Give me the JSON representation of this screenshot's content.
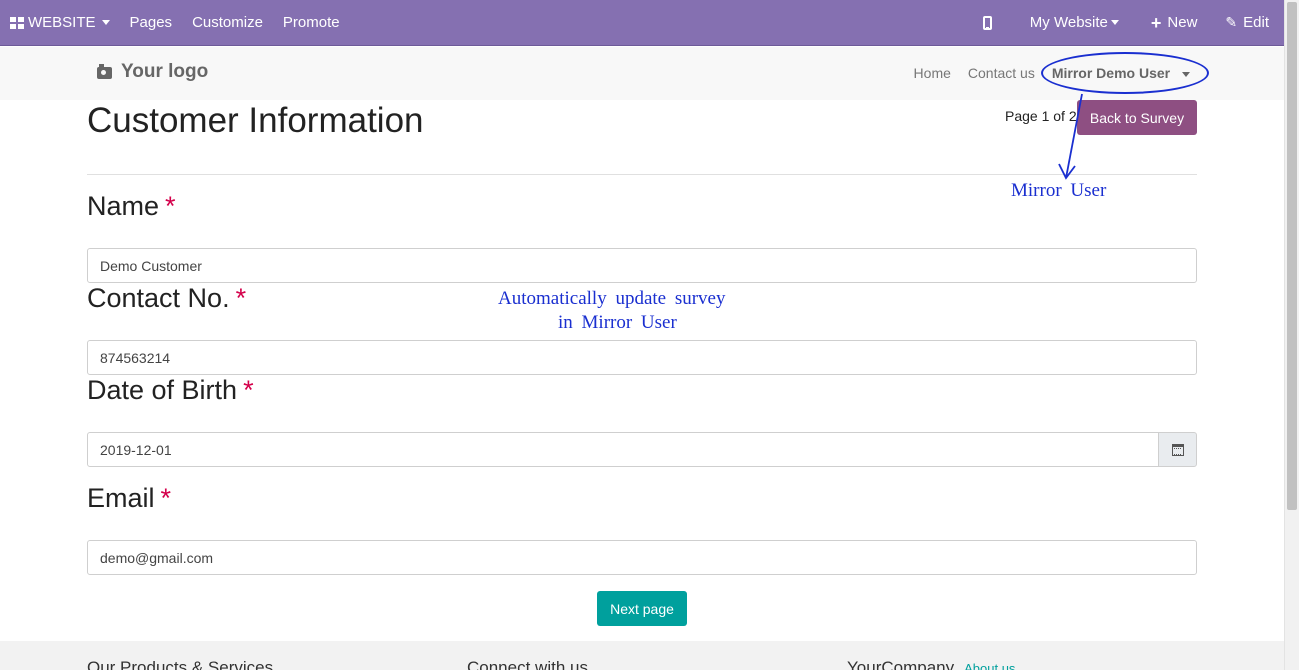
{
  "topbar": {
    "website_label": "WEBSITE",
    "pages": "Pages",
    "customize": "Customize",
    "promote": "Promote",
    "my_website": "My Website",
    "new": "New",
    "edit": "Edit",
    "color": "#8570b1"
  },
  "header": {
    "logo": "Your logo",
    "nav": {
      "home": "Home",
      "contact": "Contact us",
      "user": "Mirror Demo User"
    }
  },
  "survey": {
    "title": "Customer Information",
    "page_counter": "Page 1 of 2",
    "back_button": "Back to Survey",
    "questions": [
      {
        "label": "Name",
        "required_mark": "*",
        "value": "Demo Customer"
      },
      {
        "label": "Contact No.",
        "required_mark": "*",
        "value": "874563214"
      },
      {
        "label": "Date of Birth",
        "required_mark": "*",
        "value": "2019-12-01"
      },
      {
        "label": "Email",
        "required_mark": "*",
        "value": "demo@gmail.com"
      }
    ],
    "next_button": "Next page"
  },
  "footer": {
    "col1": "Our Products & Services",
    "col2": "Connect with us",
    "col3": "YourCompany",
    "about": "About us"
  },
  "annotations": {
    "mirror_user": "Mirror User",
    "auto_update_line1": "Automatically update survey",
    "auto_update_line2": "in Mirror User",
    "color": "#1a2fd0"
  },
  "icons": [
    "grid-icon",
    "mobile-icon",
    "plus-icon",
    "pencil-icon",
    "camera-icon",
    "calendar-icon"
  ]
}
